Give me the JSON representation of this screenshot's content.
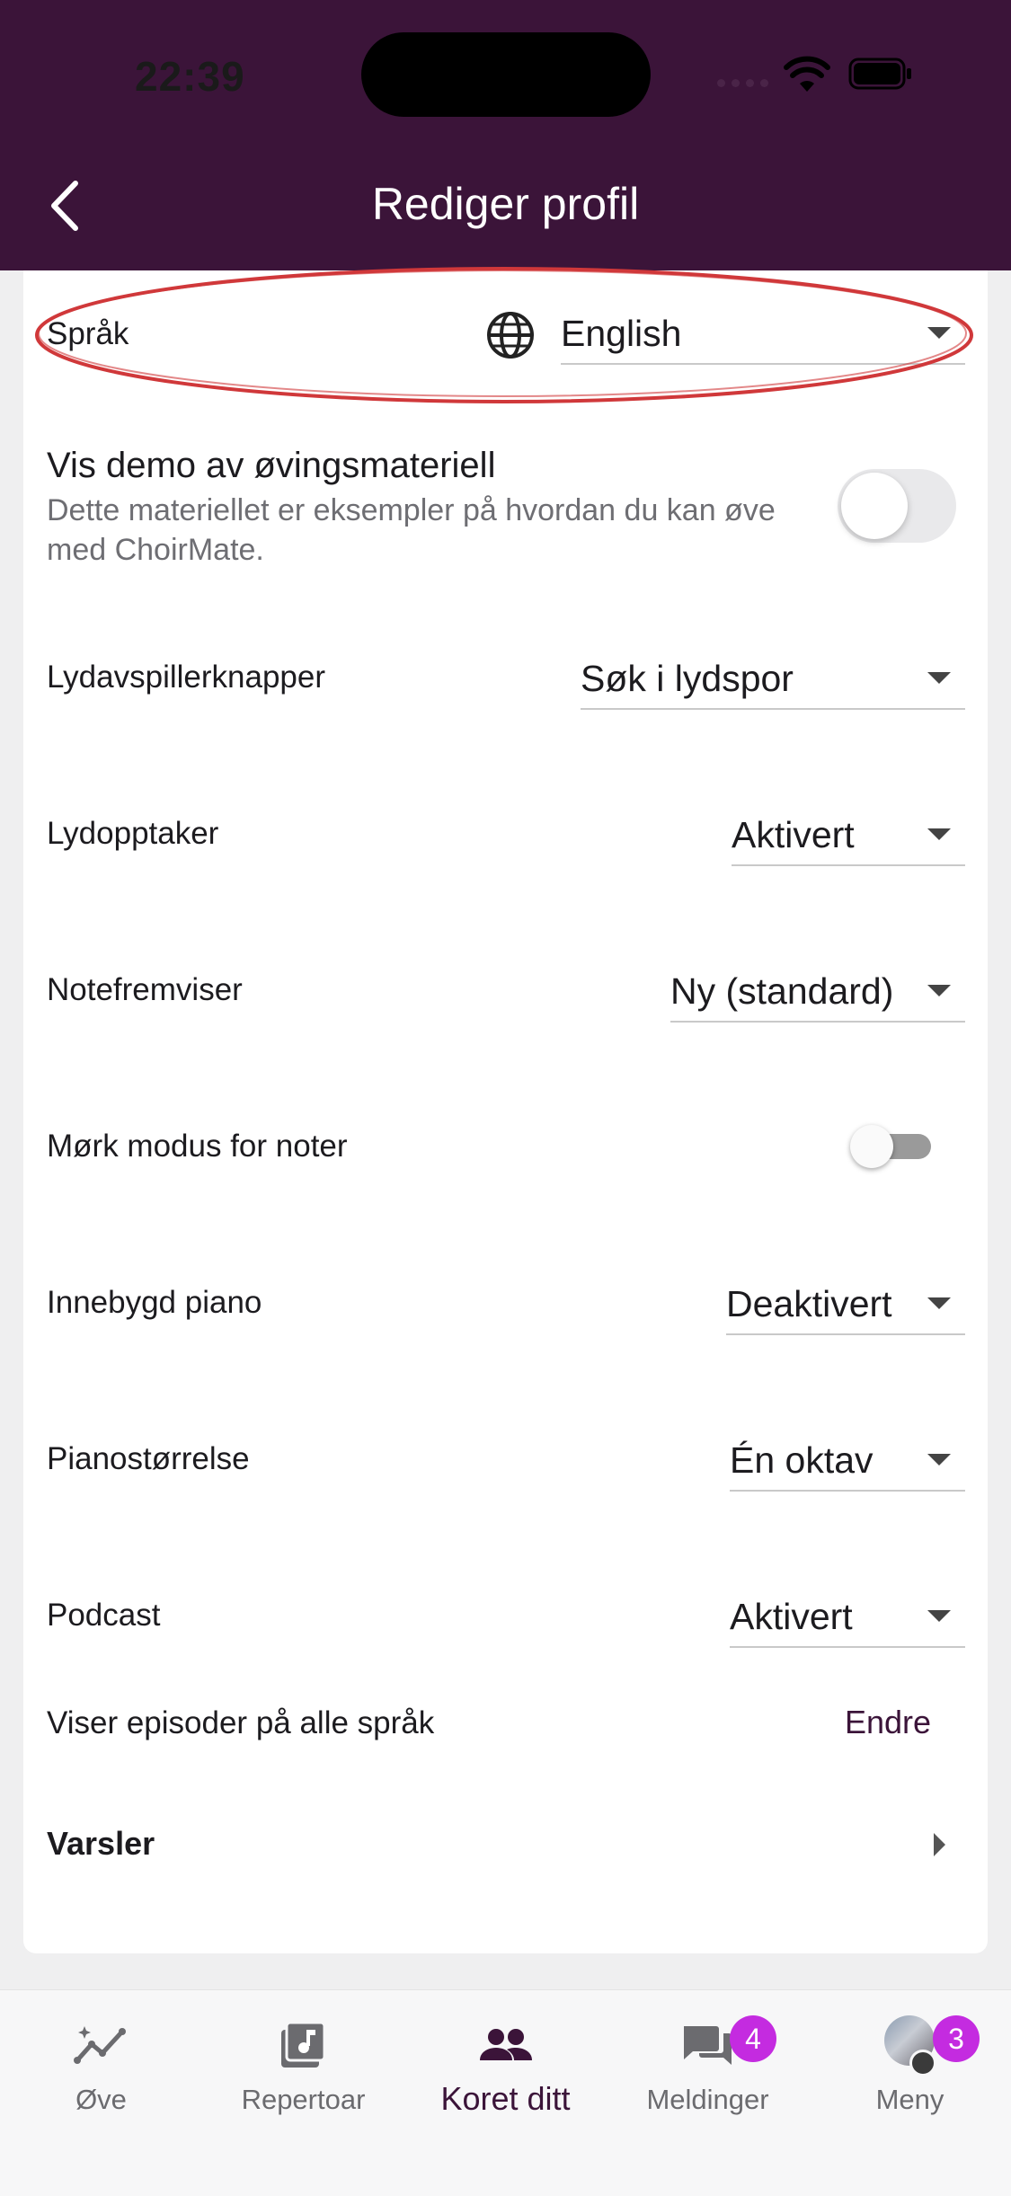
{
  "status_bar": {
    "time": "22:39"
  },
  "header": {
    "title": "Rediger profil"
  },
  "settings": {
    "language": {
      "label": "Språk",
      "value": "English"
    },
    "demo": {
      "title": "Vis demo av øvingsmateriell",
      "subtitle": "Dette materiellet er eksempler på hvordan du kan øve med ChoirMate.",
      "enabled": false
    },
    "player_buttons": {
      "label": "Lydavspillerknapper",
      "value": "Søk i lydspor"
    },
    "recorder": {
      "label": "Lydopptaker",
      "value": "Aktivert"
    },
    "sheet_viewer": {
      "label": "Notefremviser",
      "value": "Ny (standard)"
    },
    "dark_mode": {
      "label": "Mørk modus for noter",
      "enabled": false
    },
    "piano": {
      "label": "Innebygd piano",
      "value": "Deaktivert"
    },
    "piano_size": {
      "label": "Pianostørrelse",
      "value": "Én oktav"
    },
    "podcast": {
      "label": "Podcast",
      "value": "Aktivert"
    },
    "episodes": {
      "label": "Viser episoder på alle språk",
      "action": "Endre"
    },
    "notifications": {
      "label": "Varsler"
    }
  },
  "tabbar": {
    "tabs": [
      {
        "label": "Øve",
        "icon": "practice-chart-icon"
      },
      {
        "label": "Repertoar",
        "icon": "music-note-icon"
      },
      {
        "label": "Koret ditt",
        "icon": "people-icon",
        "active": true
      },
      {
        "label": "Meldinger",
        "icon": "chat-icon",
        "badge": "4"
      },
      {
        "label": "Meny",
        "icon": "avatar-icon",
        "badge": "3"
      }
    ]
  },
  "colors": {
    "header": "#3b1439",
    "accent": "#3b1439",
    "badge": "#c42be0",
    "highlight": "#d0383a"
  }
}
